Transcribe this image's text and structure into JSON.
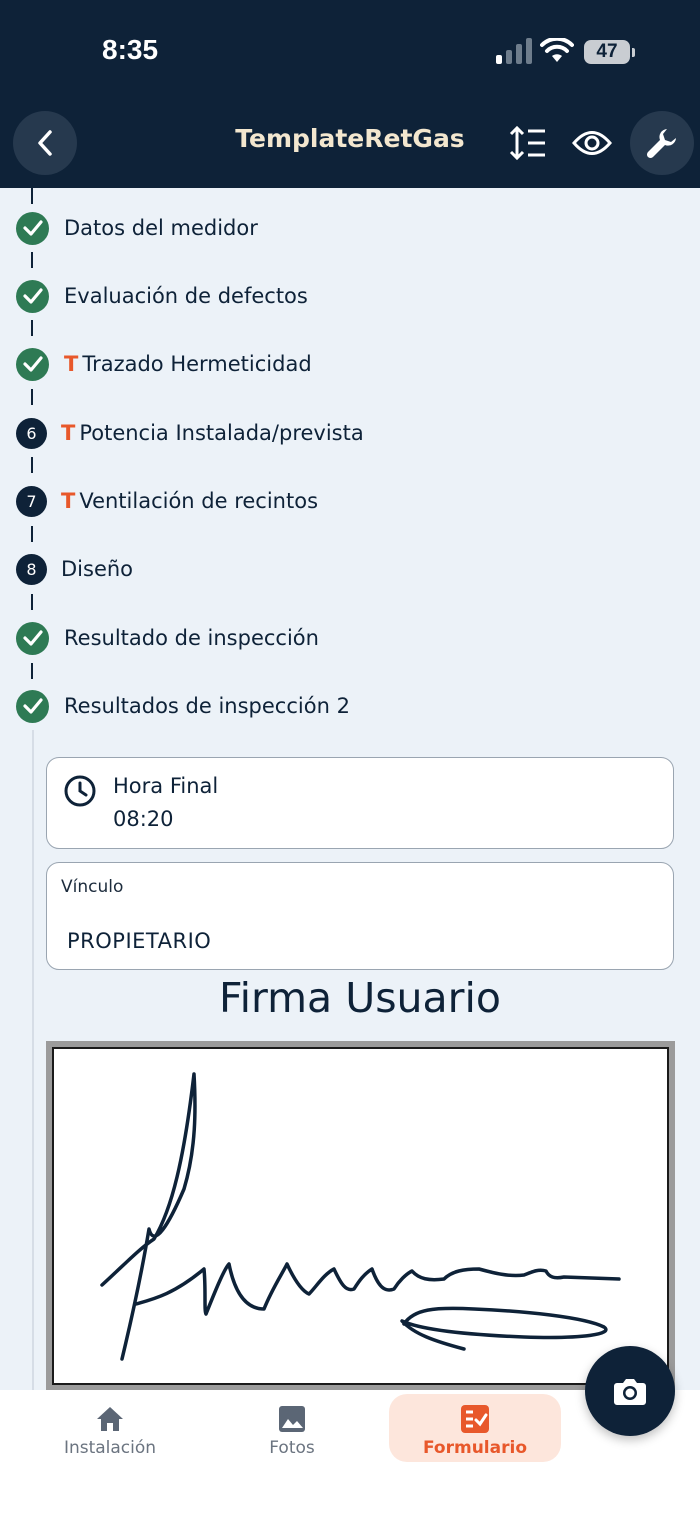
{
  "status_bar": {
    "time": "8:35",
    "battery": "47"
  },
  "header": {
    "title": "TemplateRetGas"
  },
  "steps": [
    {
      "label": "Datos del medidor",
      "state": "done",
      "t_mark": ""
    },
    {
      "label": "Evaluación de defectos",
      "state": "done",
      "t_mark": ""
    },
    {
      "label": "Trazado Hermeticidad",
      "state": "done",
      "t_mark": "T"
    },
    {
      "label": "Potencia Instalada/prevista",
      "state": "pending",
      "number": "6",
      "t_mark": "T"
    },
    {
      "label": "Ventilación de recintos",
      "state": "pending",
      "number": "7",
      "t_mark": "T"
    },
    {
      "label": "Diseño",
      "state": "pending",
      "number": "8",
      "t_mark": ""
    },
    {
      "label": "Resultado de inspección",
      "state": "done",
      "t_mark": ""
    },
    {
      "label": "Resultados de inspección 2",
      "state": "done",
      "t_mark": ""
    }
  ],
  "form": {
    "hora_final": {
      "label": "Hora Final",
      "value": "08:20"
    },
    "vinculo": {
      "label": "Vínculo",
      "value": "PROPIETARIO"
    },
    "firma_title": "Firma Usuario"
  },
  "bottom_nav": {
    "items": [
      {
        "label": "Instalación",
        "icon": "home-icon",
        "active": false
      },
      {
        "label": "Fotos",
        "icon": "image-icon",
        "active": false
      },
      {
        "label": "Formulario",
        "icon": "checklist-icon",
        "active": true
      }
    ]
  },
  "colors": {
    "header_bg": "#0e2238",
    "accent": "#e8582b",
    "check": "#2e7a54",
    "page_bg": "#ecf2f8"
  }
}
